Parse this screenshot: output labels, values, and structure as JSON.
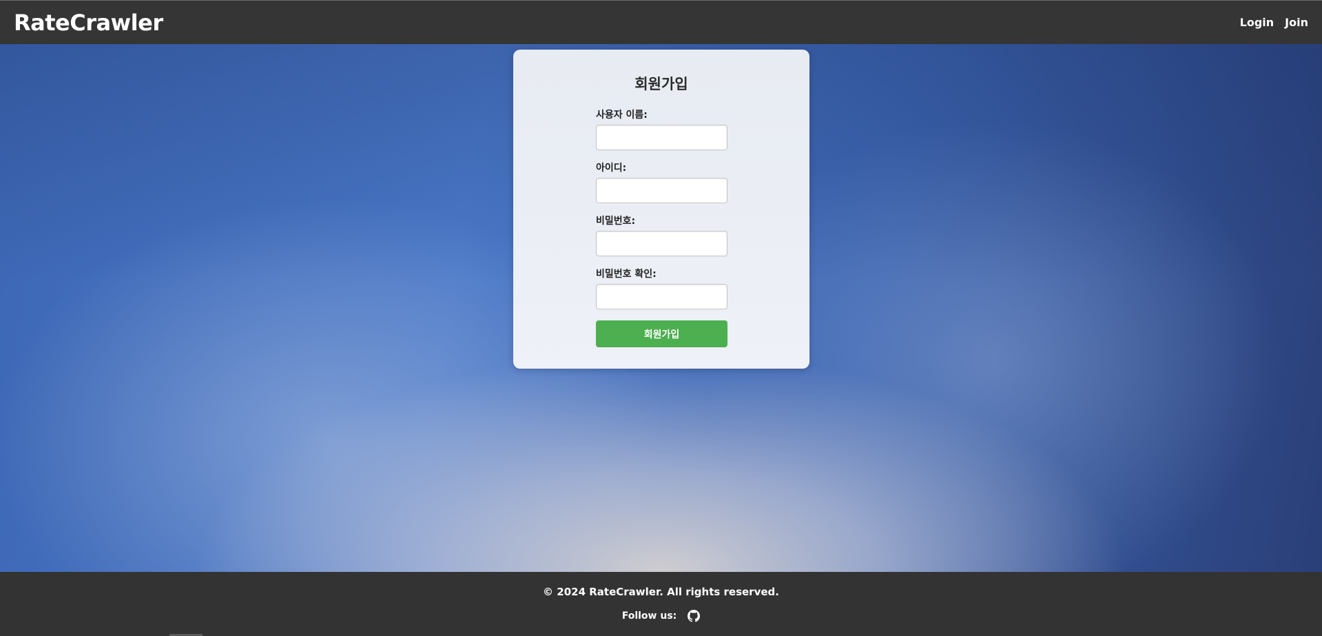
{
  "header": {
    "brand": "RateCrawler",
    "nav": {
      "login": "Login",
      "join": "Join"
    }
  },
  "form": {
    "title": "회원가입",
    "fields": {
      "username": {
        "label": "사용자 이름:",
        "value": ""
      },
      "id": {
        "label": "아이디:",
        "value": ""
      },
      "password": {
        "label": "비밀번호:",
        "value": ""
      },
      "password_confirm": {
        "label": "비밀번호 확인:",
        "value": ""
      }
    },
    "submit_label": "회원가입",
    "submit_color": "#4caf50"
  },
  "footer": {
    "copyright": "© 2024 RateCrawler. All rights reserved.",
    "follow_label": "Follow us:",
    "follow_icon": "github-icon"
  }
}
